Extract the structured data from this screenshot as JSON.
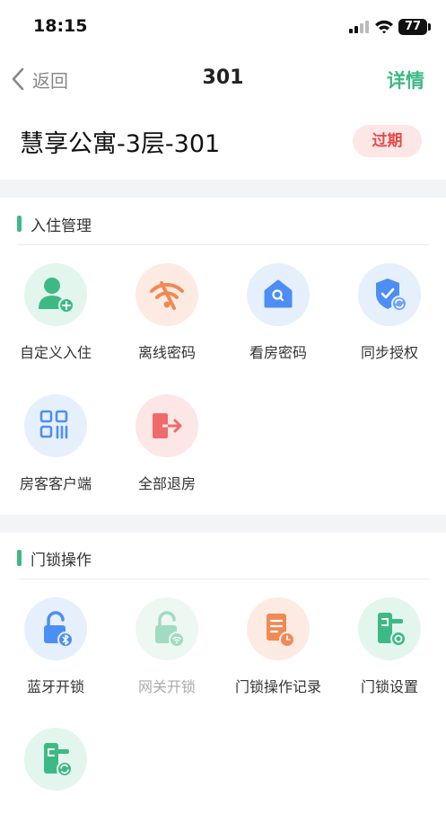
{
  "status_bar": {
    "time": "18:15",
    "battery": "77"
  },
  "nav": {
    "back_label": "返回",
    "title": "301",
    "detail_label": "详情"
  },
  "room": {
    "name": "慧享公寓-3层-301",
    "status": "过期"
  },
  "checkin_section": {
    "title": "入住管理",
    "items": [
      {
        "label": "自定义入住",
        "icon": "add-user-icon"
      },
      {
        "label": "离线密码",
        "icon": "wifi-off-icon"
      },
      {
        "label": "看房密码",
        "icon": "house-search-icon"
      },
      {
        "label": "同步授权",
        "icon": "shield-sync-icon"
      },
      {
        "label": "房客客户端",
        "icon": "qr-code-icon"
      },
      {
        "label": "全部退房",
        "icon": "checkout-icon"
      }
    ]
  },
  "lock_section": {
    "title": "门锁操作",
    "items": [
      {
        "label": "蓝牙开锁",
        "icon": "bluetooth-unlock-icon",
        "enabled": true
      },
      {
        "label": "网关开锁",
        "icon": "gateway-unlock-icon",
        "enabled": false
      },
      {
        "label": "门锁操作记录",
        "icon": "lock-log-icon",
        "enabled": true
      },
      {
        "label": "门锁设置",
        "icon": "lock-settings-icon",
        "enabled": true
      },
      {
        "label": "",
        "icon": "lock-sync-icon",
        "enabled": true
      }
    ]
  },
  "colors": {
    "accent": "#3dba84",
    "expired": "#e8484a",
    "expired_bg": "#fde6e6"
  }
}
